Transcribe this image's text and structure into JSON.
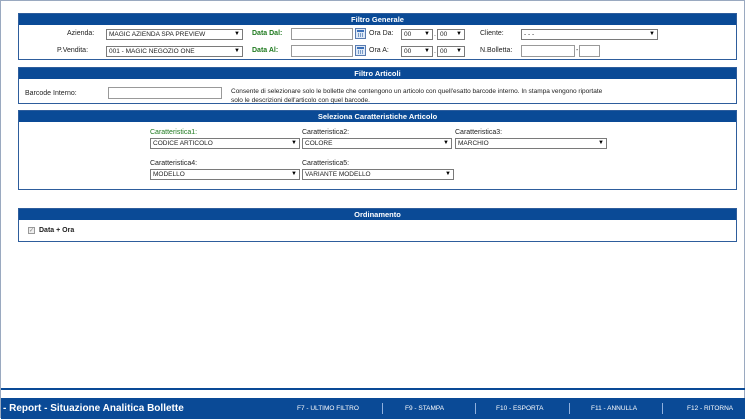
{
  "filtro_generale": {
    "title": "Filtro Generale",
    "azienda_label": "Azienda:",
    "azienda_value": "MAGIC AZIENDA SPA PREVIEW",
    "data_dal_label": "Data Dal:",
    "data_dal_value": "",
    "ora_da_label": "Ora Da:",
    "ora_da_h": "00",
    "ora_da_m": "00",
    "cliente_label": "Cliente:",
    "cliente_value": "- - -",
    "pvendita_label": "P.Vendita:",
    "pvendita_value": "001 - MAGIC NEGOZIO ONE",
    "data_al_label": "Data Al:",
    "data_al_value": "",
    "ora_a_label": "Ora A:",
    "ora_a_h": "00",
    "ora_a_m": "00",
    "nbolletta_label": "N.Bolletta:",
    "nbolletta_value1": "",
    "nbolletta_sep": "-",
    "nbolletta_value2": "",
    "dot": "."
  },
  "filtro_articoli": {
    "title": "Filtro Articoli",
    "barcode_label": "Barcode Interno:",
    "barcode_value": "",
    "description": "Consente di selezionare solo le bollette che contengono un articolo con quell'esatto barcode interno. In stampa vengono riportate solo le descrizioni dell'articolo con quel barcode."
  },
  "caratteristiche": {
    "title": "Seleziona Caratteristiche Articolo",
    "c1_label": "Caratteristica1:",
    "c1_value": "CODICE ARTICOLO",
    "c2_label": "Caratteristica2:",
    "c2_value": "COLORE",
    "c3_label": "Caratteristica3:",
    "c3_value": "MARCHIO",
    "c4_label": "Caratteristica4:",
    "c4_value": "MODELLO",
    "c5_label": "Caratteristica5:",
    "c5_value": "VARIANTE MODELLO"
  },
  "ordinamento": {
    "title": "Ordinamento",
    "option_label": "Data + Ora",
    "option_checked": true
  },
  "footer": {
    "title": "- Report - Situazione Analitica Bollette",
    "f7": "F7 - ULTIMO FILTRO",
    "f9": "F9 - STAMPA",
    "f10": "F10 - ESPORTA",
    "f11": "F11 - ANNULLA",
    "f12": "F12 - RITORNA"
  },
  "icons": {
    "dropdown_arrow": "▼",
    "calendar": "calendar-icon",
    "check": "✓"
  },
  "colors": {
    "header_blue": "#0a4a96",
    "label_green": "#1f7a1f"
  }
}
